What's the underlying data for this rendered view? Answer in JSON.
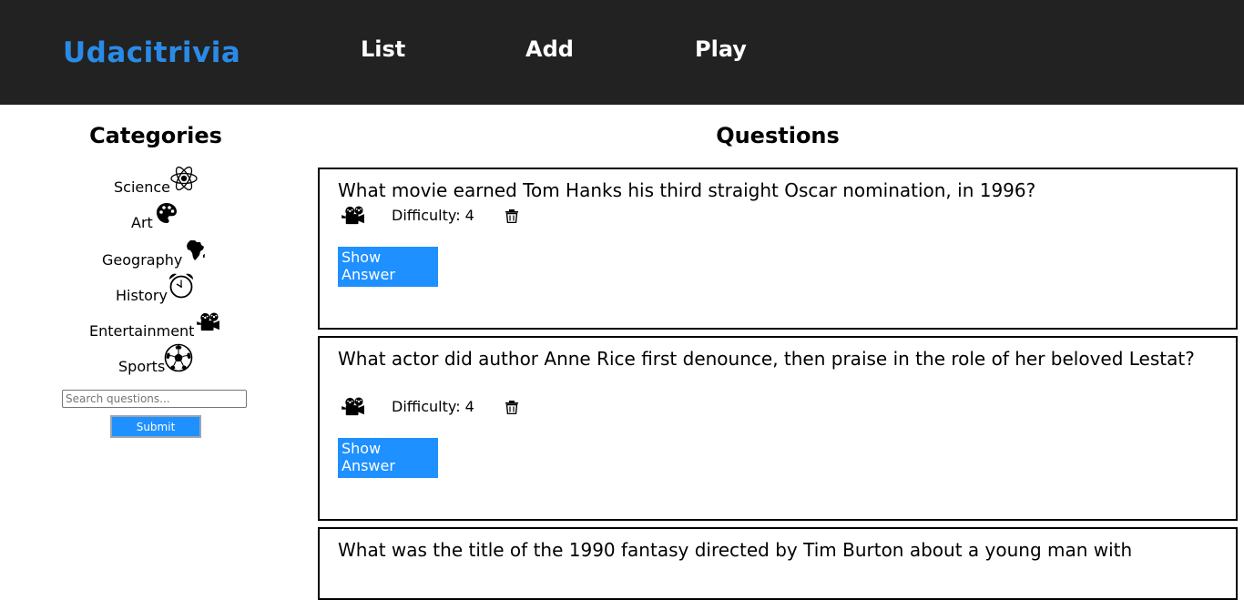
{
  "navbar": {
    "brand": "Udacitrivia",
    "links": [
      "List",
      "Add",
      "Play"
    ]
  },
  "sidebar": {
    "title": "Categories",
    "categories": [
      {
        "label": "Science",
        "icon": "atom-icon"
      },
      {
        "label": "Art",
        "icon": "palette-icon"
      },
      {
        "label": "Geography",
        "icon": "africa-map-icon"
      },
      {
        "label": "History",
        "icon": "alarm-clock-icon"
      },
      {
        "label": "Entertainment",
        "icon": "film-camera-icon"
      },
      {
        "label": "Sports",
        "icon": "soccer-ball-icon"
      }
    ],
    "search_placeholder": "Search questions...",
    "submit_label": "Submit"
  },
  "main": {
    "title": "Questions",
    "questions": [
      {
        "text": "What movie earned Tom Hanks his third straight Oscar nomination, in 1996?",
        "difficulty": "Difficulty: 4",
        "category_icon": "film-camera-icon",
        "show_answer_label": "Show Answer"
      },
      {
        "text": "What actor did author Anne Rice first denounce, then praise in the role of her beloved Lestat?",
        "difficulty": "Difficulty: 4",
        "category_icon": "film-camera-icon",
        "show_answer_label": "Show Answer"
      },
      {
        "text": "What was the title of the 1990 fantasy directed by Tim Burton about a young man with",
        "difficulty": "",
        "category_icon": "film-camera-icon",
        "show_answer_label": ""
      }
    ]
  },
  "colors": {
    "navbar_bg": "#222222",
    "brand": "#2a8be7",
    "button_bg": "#1e90ff"
  }
}
